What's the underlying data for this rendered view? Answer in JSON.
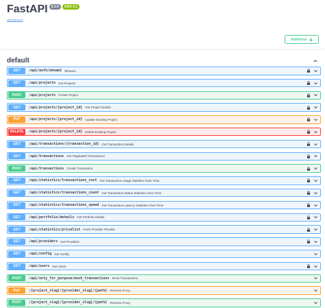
{
  "header": {
    "title": "FastAPI",
    "version_badge": "0.1.0",
    "oas_badge": "OAS 3.1",
    "openapi_link": "/openapi.json"
  },
  "auth": {
    "authorize_label": "Authorize"
  },
  "section": {
    "title": "default"
  },
  "colors": {
    "get": "#61affe",
    "post": "#49cc90",
    "put": "#fca130",
    "delete": "#f93e3e"
  },
  "operations": [
    {
      "method": "GET",
      "path": "/api/auth/whoami",
      "summary": "Whoami",
      "locked": true
    },
    {
      "method": "GET",
      "path": "/api/projects",
      "summary": "Get Projects",
      "locked": true
    },
    {
      "method": "POST",
      "path": "/api/projects",
      "summary": "Create Project",
      "locked": true
    },
    {
      "method": "GET",
      "path": "/api/projects/{project_id}",
      "summary": "Get Project Details",
      "locked": true
    },
    {
      "method": "PUT",
      "path": "/api/projects/{project_id}",
      "summary": "Update Existing Project",
      "locked": true
    },
    {
      "method": "DELETE",
      "path": "/api/projects/{project_id}",
      "summary": "Delete Existing Project",
      "locked": true
    },
    {
      "method": "GET",
      "path": "/api/transactions/{transaction_id}",
      "summary": "Get Transaction Details",
      "locked": true
    },
    {
      "method": "GET",
      "path": "/api/transactions",
      "summary": "Get Paginated Transactions",
      "locked": true
    },
    {
      "method": "POST",
      "path": "/api/transactions",
      "summary": "Create Transaction",
      "locked": true
    },
    {
      "method": "GET",
      "path": "/api/statistics/transactions_cost",
      "summary": "Get Transaction Usage Statistics Over Time",
      "locked": true
    },
    {
      "method": "GET",
      "path": "/api/statistics/transactions_count",
      "summary": "Get Transaction Status Statistics Over Time",
      "locked": true
    },
    {
      "method": "GET",
      "path": "/api/statistics/transactions_speed",
      "summary": "Get Transaction Latency Statistics Over Time",
      "locked": true
    },
    {
      "method": "GET",
      "path": "/api/portfolio/details",
      "summary": "Get Portfolio Details",
      "locked": true
    },
    {
      "method": "GET",
      "path": "/api/statistics/pricelist",
      "summary": "Fetch Provider Pricelist",
      "locked": true
    },
    {
      "method": "GET",
      "path": "/api/providers",
      "summary": "Get Providers",
      "locked": true
    },
    {
      "method": "GET",
      "path": "/api/config",
      "summary": "Get Config",
      "locked": false
    },
    {
      "method": "GET",
      "path": "/api/users",
      "summary": "Get Users",
      "locked": true
    },
    {
      "method": "POST",
      "path": "/api/only_for_purpose/mock_transactions",
      "summary": "Mock Transactions",
      "locked": false
    },
    {
      "method": "PUT",
      "path": "/{project_slug}/{provider_slug}/{path}",
      "summary": "Reverse Proxy",
      "locked": false
    },
    {
      "method": "POST",
      "path": "/{project_slug}/{provider_slug}/{path}",
      "summary": "Reverse Proxy",
      "locked": false
    }
  ]
}
